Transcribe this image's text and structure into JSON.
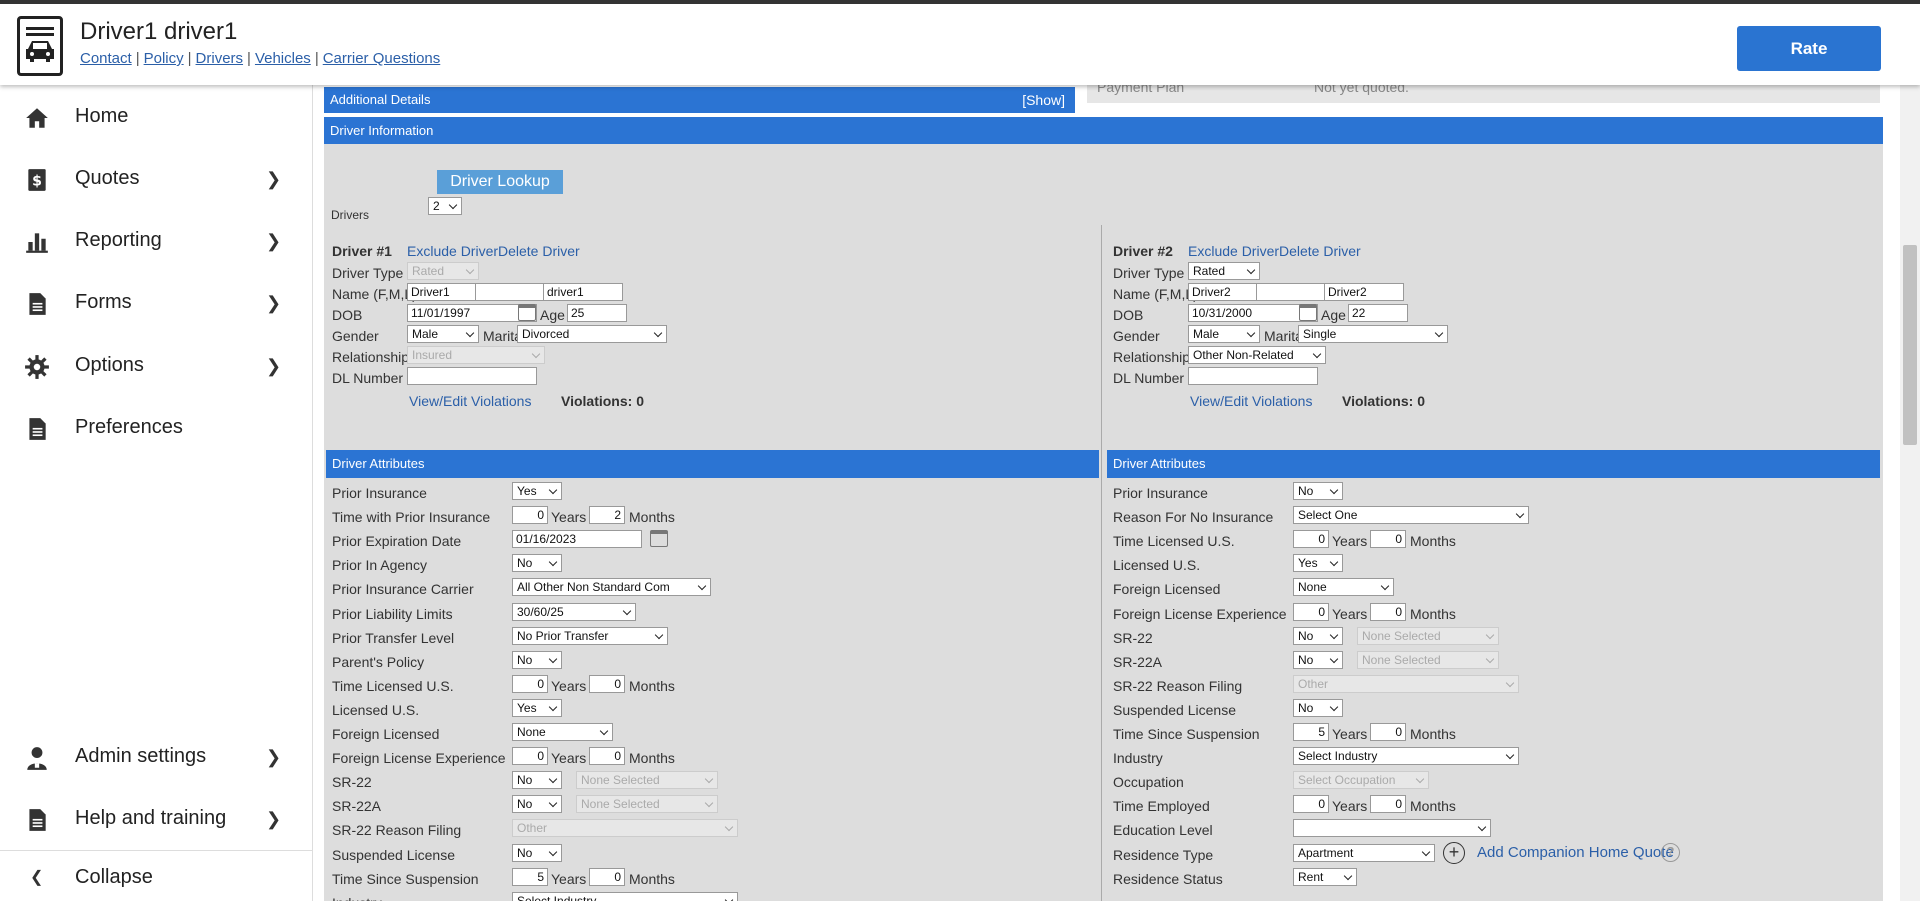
{
  "header": {
    "title": "Driver1 driver1",
    "links": [
      "Contact",
      "Policy",
      "Drivers",
      "Vehicles",
      "Carrier Questions"
    ],
    "rate_label": "Rate"
  },
  "sidebar": {
    "items": [
      {
        "label": "Home",
        "icon": "home-icon"
      },
      {
        "label": "Quotes",
        "icon": "dollar-doc-icon"
      },
      {
        "label": "Reporting",
        "icon": "bar-chart-icon"
      },
      {
        "label": "Forms",
        "icon": "document-icon"
      },
      {
        "label": "Options",
        "icon": "gear-icon"
      },
      {
        "label": "Preferences",
        "icon": "document-icon"
      }
    ],
    "admin": "Admin settings",
    "help": "Help and training",
    "collapse": "Collapse"
  },
  "top": {
    "additional_details": "Additional Details",
    "show": "[Show]",
    "payment_plan_label": "Payment Plan",
    "payment_plan_value": "Not yet quoted."
  },
  "driver_info": {
    "title": "Driver Information",
    "lookup": "Driver Lookup",
    "drivers_label": "Drivers",
    "drivers_count": "2"
  },
  "labels": {
    "exclude": "Exclude Driver",
    "delete": "Delete Driver",
    "driver_type": "Driver Type",
    "name": "Name (F,M,L)",
    "dob": "DOB",
    "age": "Age",
    "gender": "Gender",
    "marital": "Marital",
    "relationship": "Relationship",
    "dl": "DL Number",
    "view_edit": "View/Edit Violations",
    "violations": "Violations: 0",
    "attributes": "Driver Attributes",
    "years": "Years",
    "months": "Months",
    "add_companion": "Add Companion Home Quote"
  },
  "driver1": {
    "heading": "Driver #1",
    "type": "Rated",
    "first": "Driver1",
    "middle": "",
    "last": "driver1",
    "dob": "11/01/1997",
    "age": "25",
    "gender": "Male",
    "marital": "Divorced",
    "relationship": "Insured",
    "dl": "",
    "attrs": [
      {
        "label": "Prior Insurance",
        "kind": "sel",
        "value": "Yes",
        "w": 50
      },
      {
        "label": "Time with Prior Insurance",
        "kind": "ym",
        "years": "0",
        "months": "2"
      },
      {
        "label": "Prior Expiration Date",
        "kind": "date",
        "value": "01/16/2023"
      },
      {
        "label": "Prior In Agency",
        "kind": "sel",
        "value": "No",
        "w": 50
      },
      {
        "label": "Prior Insurance Carrier",
        "kind": "sel",
        "value": "All Other Non Standard Com",
        "w": 199
      },
      {
        "label": "Prior Liability Limits",
        "kind": "sel",
        "value": "30/60/25",
        "w": 124
      },
      {
        "label": "Prior Transfer Level",
        "kind": "sel",
        "value": "No Prior Transfer",
        "w": 156
      },
      {
        "label": "Parent's Policy",
        "kind": "sel",
        "value": "No",
        "w": 50
      },
      {
        "label": "Time Licensed U.S.",
        "kind": "ym",
        "years": "0",
        "months": "0"
      },
      {
        "label": "Licensed U.S.",
        "kind": "sel",
        "value": "Yes",
        "w": 50
      },
      {
        "label": "Foreign Licensed",
        "kind": "sel",
        "value": "None",
        "w": 101
      },
      {
        "label": "Foreign License Experience",
        "kind": "ym",
        "years": "0",
        "months": "0"
      },
      {
        "label": "SR-22",
        "kind": "sel2",
        "value": "No",
        "value2": "None Selected"
      },
      {
        "label": "SR-22A",
        "kind": "sel2",
        "value": "No",
        "value2": "None Selected"
      },
      {
        "label": "SR-22 Reason Filing",
        "kind": "seldis",
        "value": "Other",
        "w": 226
      },
      {
        "label": "Suspended License",
        "kind": "sel",
        "value": "No",
        "w": 50
      },
      {
        "label": "Time Since Suspension",
        "kind": "ym",
        "years": "5",
        "months": "0"
      },
      {
        "label": "Industry",
        "kind": "sel",
        "value": "Select Industry",
        "w": 226
      }
    ]
  },
  "driver2": {
    "heading": "Driver #2",
    "type": "Rated",
    "first": "Driver2",
    "middle": "",
    "last": "Driver2",
    "dob": "10/31/2000",
    "age": "22",
    "gender": "Male",
    "marital": "Single",
    "relationship": "Other Non-Related",
    "dl": "",
    "attrs": [
      {
        "label": "Prior Insurance",
        "kind": "sel",
        "value": "No",
        "w": 50
      },
      {
        "label": "Reason For No Insurance",
        "kind": "sel",
        "value": "Select One",
        "w": 236
      },
      {
        "label": "Time Licensed U.S.",
        "kind": "ym",
        "years": "0",
        "months": "0"
      },
      {
        "label": "Licensed U.S.",
        "kind": "sel",
        "value": "Yes",
        "w": 50
      },
      {
        "label": "Foreign Licensed",
        "kind": "sel",
        "value": "None",
        "w": 101
      },
      {
        "label": "Foreign License Experience",
        "kind": "ym",
        "years": "0",
        "months": "0"
      },
      {
        "label": "SR-22",
        "kind": "sel2",
        "value": "No",
        "value2": "None Selected"
      },
      {
        "label": "SR-22A",
        "kind": "sel2",
        "value": "No",
        "value2": "None Selected"
      },
      {
        "label": "SR-22 Reason Filing",
        "kind": "seldis",
        "value": "Other",
        "w": 226
      },
      {
        "label": "Suspended License",
        "kind": "sel",
        "value": "No",
        "w": 50
      },
      {
        "label": "Time Since Suspension",
        "kind": "ym",
        "years": "5",
        "months": "0"
      },
      {
        "label": "Industry",
        "kind": "sel",
        "value": "Select Industry",
        "w": 226
      },
      {
        "label": "Occupation",
        "kind": "seldis",
        "value": "Select Occupation",
        "w": 136
      },
      {
        "label": "Time Employed",
        "kind": "ym",
        "years": "0",
        "months": "0"
      },
      {
        "label": "Education Level",
        "kind": "sel",
        "value": "",
        "w": 198
      },
      {
        "label": "Residence Type",
        "kind": "residence",
        "value": "Apartment",
        "w": 142
      },
      {
        "label": "Residence Status",
        "kind": "sel",
        "value": "Rent",
        "w": 64
      }
    ]
  }
}
